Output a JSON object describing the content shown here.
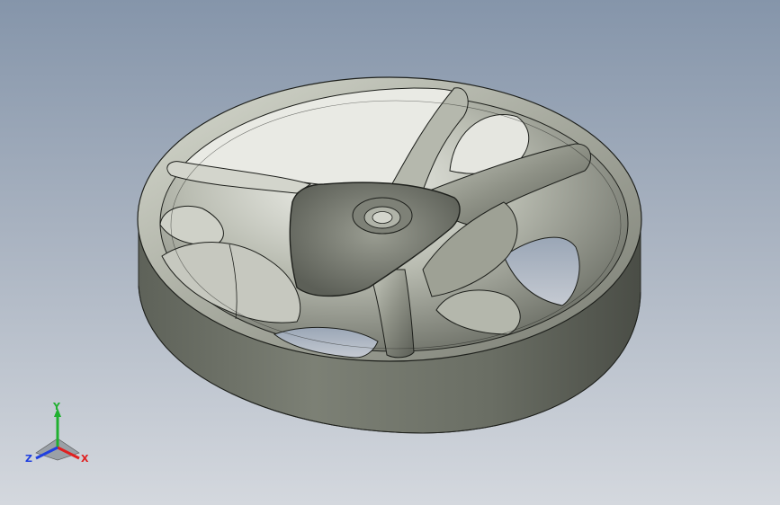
{
  "viewport": {
    "background_top": "#8595aa",
    "background_bottom": "#d4d8de",
    "model_color": "#8c8f84",
    "edge_color": "#1e201c"
  },
  "triad": {
    "x_label": "X",
    "y_label": "Y",
    "z_label": "Z",
    "x_color": "#e02020",
    "y_color": "#20b030",
    "z_color": "#2040e0"
  }
}
